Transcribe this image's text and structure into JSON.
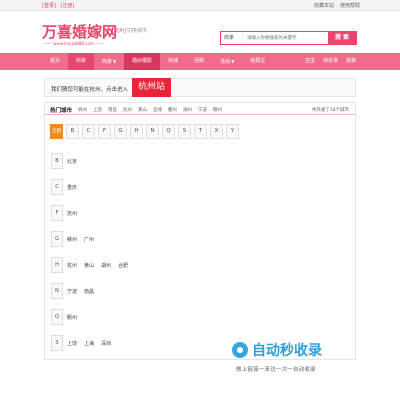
{
  "topbar": {
    "left": [
      "[登录]",
      "[注册]"
    ],
    "right": [
      "收藏本站",
      "使用帮助"
    ]
  },
  "header": {
    "logo": "万喜婚嫁网",
    "logo_sub": "—— www.hunjia888.com ——",
    "city_tag": "[杭州]",
    "city_switch": "切换城市"
  },
  "search": {
    "category": "商家",
    "placeholder": "请输入你要搜索的关键字",
    "button": "搜 索"
  },
  "nav": {
    "items": [
      {
        "label": "首页",
        "active": false,
        "hot": false,
        "caret": false
      },
      {
        "label": "商家",
        "active": true,
        "hot": false,
        "caret": false
      },
      {
        "label": "商家",
        "active": false,
        "hot": false,
        "caret": true
      },
      {
        "label": "婚纱摄影",
        "active": false,
        "hot": true,
        "caret": false
      },
      {
        "label": "商城",
        "active": false,
        "hot": false,
        "caret": false
      },
      {
        "label": "团购",
        "active": false,
        "hot": false,
        "caret": false
      },
      {
        "label": "活动",
        "active": false,
        "hot": false,
        "caret": true
      },
      {
        "label": "结婚宝",
        "active": false,
        "hot": false,
        "caret": false
      }
    ],
    "right": [
      "宝宝",
      "简名录",
      "投稿"
    ]
  },
  "notice": {
    "text": "我们猜您可能在杭州，点击进入",
    "city": "杭州站"
  },
  "hotbar": {
    "title": "热门城市",
    "cities": [
      "杭州",
      "上饶",
      "南昌",
      "抚州",
      "黄山",
      "宣城",
      "衢州",
      "湖州",
      "宁波",
      "赣州"
    ],
    "count": "共开通了18个城市"
  },
  "letters": {
    "all": "全部",
    "items": [
      "B",
      "C",
      "F",
      "G",
      "H",
      "N",
      "Q",
      "S",
      "T",
      "X",
      "Y"
    ]
  },
  "groups": [
    {
      "key": "B",
      "names": [
        "北京"
      ]
    },
    {
      "key": "C",
      "names": [
        "重庆"
      ]
    },
    {
      "key": "F",
      "names": [
        "抚州"
      ]
    },
    {
      "key": "G",
      "names": [
        "赣州",
        "广州"
      ]
    },
    {
      "key": "H",
      "names": [
        "杭州",
        "黄山",
        "湖州",
        "合肥"
      ]
    },
    {
      "key": "N",
      "names": [
        "宁波",
        "南昌"
      ]
    },
    {
      "key": "Q",
      "names": [
        "衢州"
      ]
    },
    {
      "key": "S",
      "names": [
        "上饶",
        "上海",
        "深圳"
      ]
    }
  ],
  "watermark": {
    "brand": "自动秒收录",
    "slogan": "做上链接一来访一次一自动收录"
  }
}
